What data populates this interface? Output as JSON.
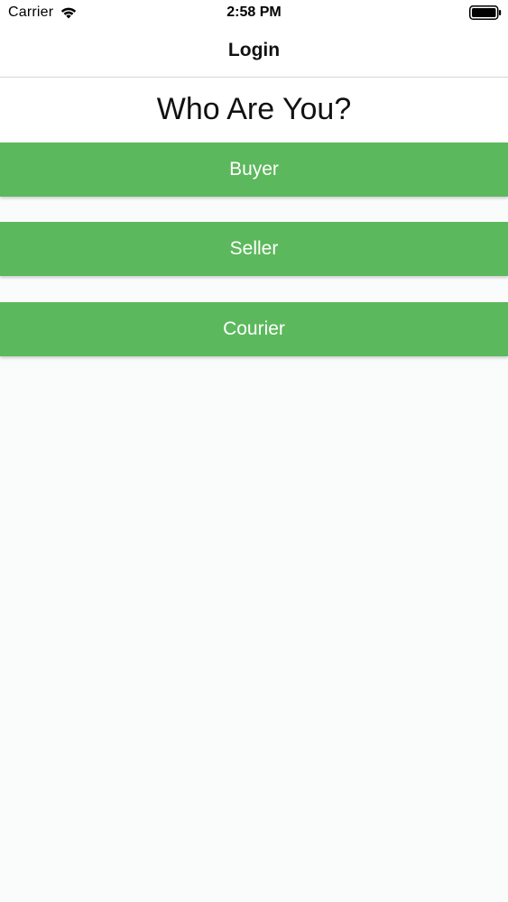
{
  "status_bar": {
    "carrier": "Carrier",
    "time": "2:58 PM",
    "wifi_icon": "wifi-icon",
    "battery_icon": "battery-full-icon"
  },
  "nav": {
    "title": "Login"
  },
  "main": {
    "heading": "Who Are You?",
    "roles": [
      {
        "label": "Buyer"
      },
      {
        "label": "Seller"
      },
      {
        "label": "Courier"
      }
    ]
  },
  "colors": {
    "button_green": "#5cb85c",
    "button_text": "#ffffff",
    "background": "#fafbfb"
  }
}
